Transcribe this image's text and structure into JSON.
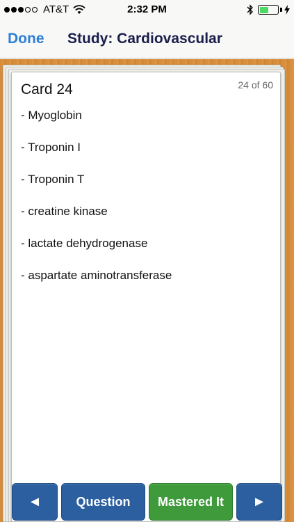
{
  "status_bar": {
    "carrier": "AT&T",
    "signal_bars_filled": 3,
    "signal_bars_total": 5,
    "time": "2:32 PM",
    "battery_level": 0.5
  },
  "nav": {
    "done_label": "Done",
    "title": "Study: Cardiovascular"
  },
  "card": {
    "title": "Card 24",
    "counter": "24 of 60",
    "items": [
      "- Myoglobin",
      "- Troponin I",
      "- Troponin T",
      "- creatine kinase",
      "- lactate dehydrogenase",
      "- aspartate aminotransferase"
    ]
  },
  "toolbar": {
    "prev_icon": "◄",
    "question_label": "Question",
    "mastered_label": "Mastered It",
    "next_icon": "►"
  },
  "colors": {
    "accent": "#2f80d8",
    "nav_title": "#1a1f4d",
    "button_blue": "#2c5fa0",
    "button_green": "#3e9a3a",
    "wood": "#d48a3a",
    "battery_green": "#4cd964"
  }
}
